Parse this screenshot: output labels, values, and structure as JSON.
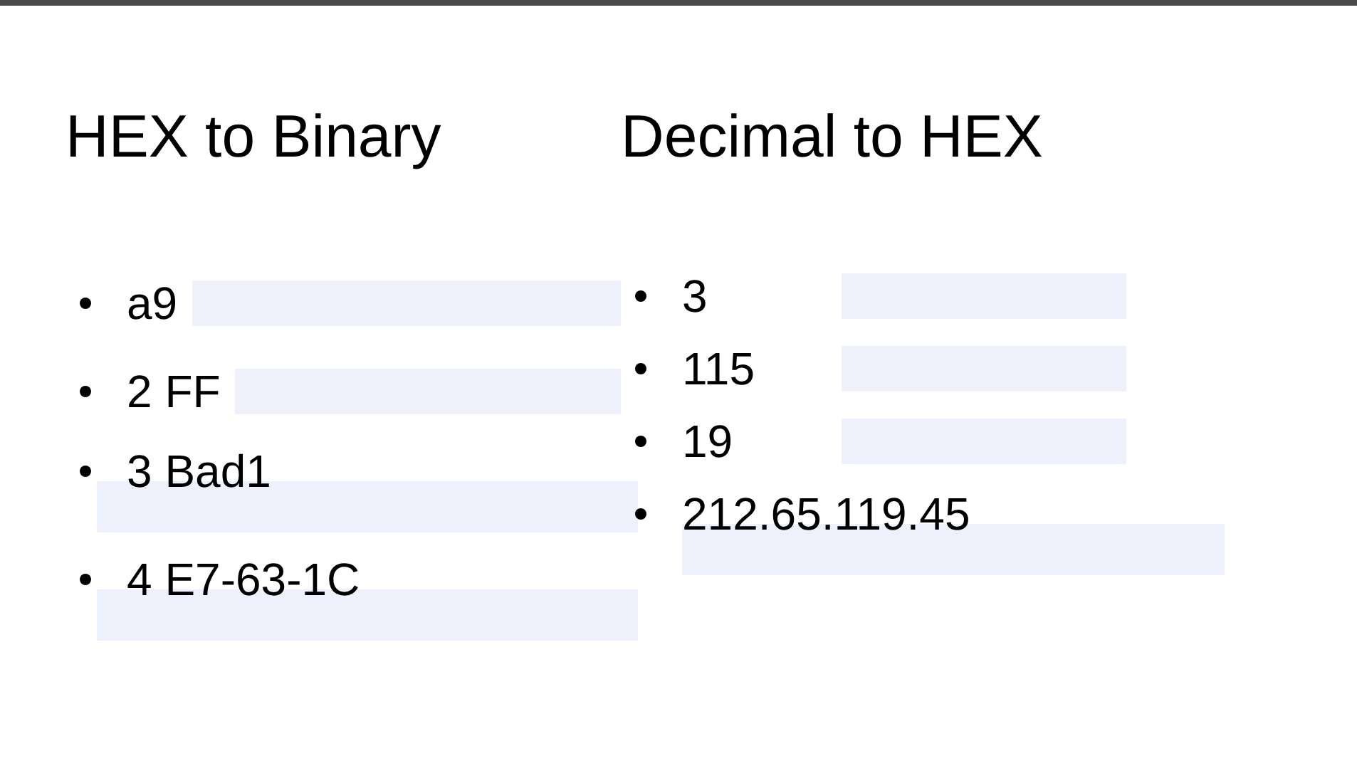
{
  "columns": [
    {
      "title": "HEX to Binary",
      "items": [
        {
          "text": "a9",
          "kind": "inline"
        },
        {
          "text": "2 FF",
          "kind": "inline"
        },
        {
          "text": "3 Bad1",
          "kind": "below"
        },
        {
          "text": "4 E7-63-1C",
          "kind": "below"
        }
      ]
    },
    {
      "title": "Decimal to HEX",
      "items": [
        {
          "text": "3",
          "kind": "inline"
        },
        {
          "text": "115",
          "kind": "inline"
        },
        {
          "text": "19",
          "kind": "inline"
        },
        {
          "text": "212.65.119.45",
          "kind": "below"
        }
      ]
    }
  ]
}
